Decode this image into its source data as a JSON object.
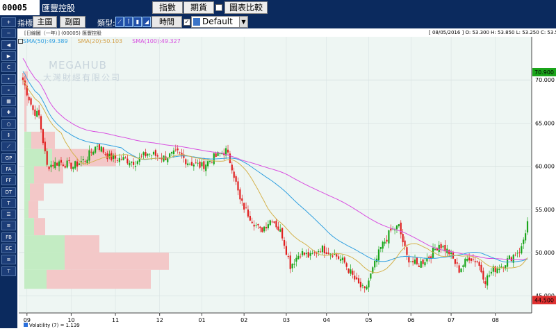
{
  "topbar": {
    "code": "00005",
    "name": "匯豐控股",
    "buttons": [
      "指數",
      "期貨",
      "圖表比較"
    ]
  },
  "toolbar2": {
    "indicator_label": "指標:",
    "main_chart": "主圖",
    "sub_chart": "副圖",
    "type_label": "類型:",
    "type_icons": [
      "line-type-icon",
      "bar-type-icon",
      "candle-type-icon",
      "area-type-icon"
    ],
    "time_button": "時間",
    "checkbox_mark": "✓",
    "preset": "Default"
  },
  "sidebar": {
    "buttons": [
      "+",
      "−",
      "◀",
      "▶",
      "C",
      "•",
      "∘",
      "▦",
      "✚",
      "○",
      "↕",
      "⟋",
      "GP",
      "FA",
      "FF",
      "DT",
      "T",
      "☰",
      "≡",
      "FB",
      "EC",
      "≡",
      "⊤"
    ]
  },
  "chart_header": {
    "title": "[日線圖（一年）] (00005) 匯豐控股",
    "ohlc": "[ 08/05/2016 ] O: 53.300  H: 53.850  L: 53.250  C: 53.500",
    "sma50": "SMA(50):49.389",
    "sma20": "SMA(20):50.103",
    "sma100": "SMA(100):49.327",
    "watermark_en": "MEGAHUB",
    "watermark_zh": "大灣財經有限公司",
    "volatility": "Volatility (7) = 1.139"
  },
  "colors": {
    "sma50": "#2f9fe0",
    "sma20": "#d4b24c",
    "sma100": "#d84ee0",
    "up": "#1aa51a",
    "down": "#e02020",
    "label_high": "#1aa51a",
    "label_low": "#e03030",
    "vp_green": "#c3ecc3",
    "vp_red": "#f3c8c8",
    "plot_bg": "#eef6f3"
  },
  "chart_data": {
    "type": "candlestick",
    "x_ticks": [
      "09",
      "10",
      "11",
      "12",
      "01",
      "02",
      "03",
      "04",
      "05",
      "06",
      "07",
      "08"
    ],
    "y_ticks": [
      "70.000",
      "65.000",
      "60.000",
      "55.000",
      "50.000",
      "45.000"
    ],
    "ylim": [
      43,
      75
    ],
    "high_label": "70.900",
    "low_label": "44.500",
    "anchors": [
      {
        "t": 0,
        "c": 70.0
      },
      {
        "t": 5,
        "c": 66.5
      },
      {
        "t": 8,
        "c": 65.8
      },
      {
        "t": 12,
        "c": 60.0
      },
      {
        "t": 18,
        "c": 60.5
      },
      {
        "t": 25,
        "c": 60.0
      },
      {
        "t": 31,
        "c": 60.8
      },
      {
        "t": 37,
        "c": 62.5
      },
      {
        "t": 43,
        "c": 61.0
      },
      {
        "t": 50,
        "c": 60.8
      },
      {
        "t": 56,
        "c": 60.5
      },
      {
        "t": 62,
        "c": 61.5
      },
      {
        "t": 70,
        "c": 61.0
      },
      {
        "t": 77,
        "c": 61.5
      },
      {
        "t": 82,
        "c": 60.5
      },
      {
        "t": 89,
        "c": 60.0
      },
      {
        "t": 95,
        "c": 61.0
      },
      {
        "t": 101,
        "c": 61.8
      },
      {
        "t": 104,
        "c": 60.0
      },
      {
        "t": 108,
        "c": 56.0
      },
      {
        "t": 112,
        "c": 54.5
      },
      {
        "t": 118,
        "c": 52.5
      },
      {
        "t": 124,
        "c": 54.0
      },
      {
        "t": 129,
        "c": 52.0
      },
      {
        "t": 133,
        "c": 48.5
      },
      {
        "t": 138,
        "c": 50.0
      },
      {
        "t": 143,
        "c": 49.5
      },
      {
        "t": 148,
        "c": 50.5
      },
      {
        "t": 154,
        "c": 50.0
      },
      {
        "t": 160,
        "c": 48.8
      },
      {
        "t": 166,
        "c": 46.5
      },
      {
        "t": 170,
        "c": 45.5
      },
      {
        "t": 174,
        "c": 48.0
      },
      {
        "t": 178,
        "c": 50.5
      },
      {
        "t": 183,
        "c": 52.5
      },
      {
        "t": 187,
        "c": 53.0
      },
      {
        "t": 191,
        "c": 49.5
      },
      {
        "t": 196,
        "c": 48.5
      },
      {
        "t": 202,
        "c": 49.5
      },
      {
        "t": 207,
        "c": 51.0
      },
      {
        "t": 212,
        "c": 50.0
      },
      {
        "t": 217,
        "c": 48.0
      },
      {
        "t": 222,
        "c": 49.5
      },
      {
        "t": 226,
        "c": 49.0
      },
      {
        "t": 230,
        "c": 46.8
      },
      {
        "t": 234,
        "c": 48.0
      },
      {
        "t": 238,
        "c": 48.5
      },
      {
        "t": 243,
        "c": 49.5
      },
      {
        "t": 248,
        "c": 50.5
      },
      {
        "t": 251,
        "c": 53.5
      }
    ],
    "volume_profile": [
      {
        "lo": 67,
        "hi": 71,
        "green": 0,
        "red": 5
      },
      {
        "lo": 64,
        "hi": 67,
        "green": 0,
        "red": 3
      },
      {
        "lo": 62,
        "hi": 64,
        "green": 10,
        "red": 34
      },
      {
        "lo": 60,
        "hi": 62,
        "green": 40,
        "red": 92
      },
      {
        "lo": 58,
        "hi": 60,
        "green": 14,
        "red": 42
      },
      {
        "lo": 56,
        "hi": 58,
        "green": 8,
        "red": 20
      },
      {
        "lo": 54,
        "hi": 56,
        "green": 6,
        "red": 14
      },
      {
        "lo": 52,
        "hi": 54,
        "green": 14,
        "red": 16
      },
      {
        "lo": 50,
        "hi": 52,
        "green": 58,
        "red": 50
      },
      {
        "lo": 48,
        "hi": 50,
        "green": 58,
        "red": 150
      },
      {
        "lo": 45.8,
        "hi": 48,
        "green": 32,
        "red": 150
      }
    ]
  }
}
